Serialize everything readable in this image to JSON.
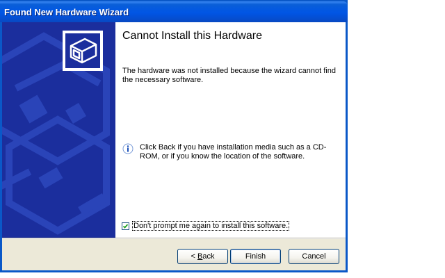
{
  "window": {
    "title": "Found New Hardware Wizard"
  },
  "page": {
    "heading": "Cannot Install this Hardware",
    "description": "The hardware was not installed because the wizard cannot find the necessary software.",
    "info_text": "Click Back if you have installation media such as a CD-ROM, or if you know the location of the software.",
    "dont_prompt_label": "Don't prompt me again to install this software.",
    "dont_prompt_checked": true
  },
  "buttons": {
    "back_prefix": "< ",
    "back_mnemonic": "B",
    "back_rest": "ack",
    "finish": "Finish",
    "cancel": "Cancel"
  },
  "icons": {
    "wizard": "hardware-install-icon",
    "info": "info-icon",
    "checkmark": "check-icon"
  },
  "colors": {
    "titlebar": "#0055e5",
    "sidebar": "#1b2e9d",
    "dialog_face": "#ece9d8"
  }
}
